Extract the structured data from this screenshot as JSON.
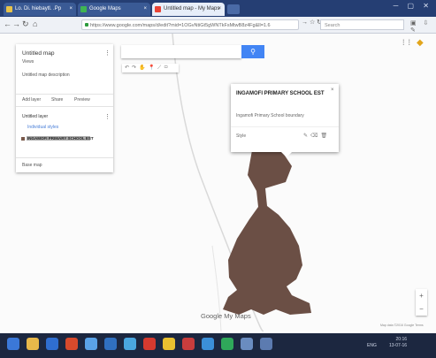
{
  "browser": {
    "tabs": [
      {
        "label": "Lo. Di. hiebaytl. .Pp",
        "active": false
      },
      {
        "label": "Google Maps",
        "active": false
      },
      {
        "label": "Untitled map - My Maps",
        "active": true
      }
    ],
    "url": "https://www.google.com/maps/d/edit?mid=1OGvNtiGt5gWNTkFsMtwB8z4Fg&ll=1.6",
    "search_placeholder": "Search"
  },
  "map": {
    "title": "Untitled map",
    "subtitle": "Views",
    "description": "Untitled map description",
    "actions": {
      "add_layer": "Add layer",
      "share": "Share",
      "preview": "Preview"
    },
    "layer_name": "Untitled layer",
    "layer_style": "Individual styles",
    "feature_name": "INGAMOFI PRIMARY SCHOOL EST",
    "base_map": "Base map",
    "search_button_icon": "search-icon"
  },
  "info_card": {
    "title": "INGAMOFI PRIMARY SCHOOL EST",
    "detail": "Ingamofi Primary School boundary",
    "footer": "Style"
  },
  "footer": {
    "logo": "Google My Maps",
    "attribution": "Map data ©2016 Google  Terms"
  },
  "taskbar": {
    "time": "20:16",
    "date": "13-07-16",
    "lang": "ENG"
  },
  "colors": {
    "polygon": "#6b4f45",
    "accent": "#4285f4",
    "tabbar": "#253e73",
    "taskbar": "#1c2740"
  }
}
